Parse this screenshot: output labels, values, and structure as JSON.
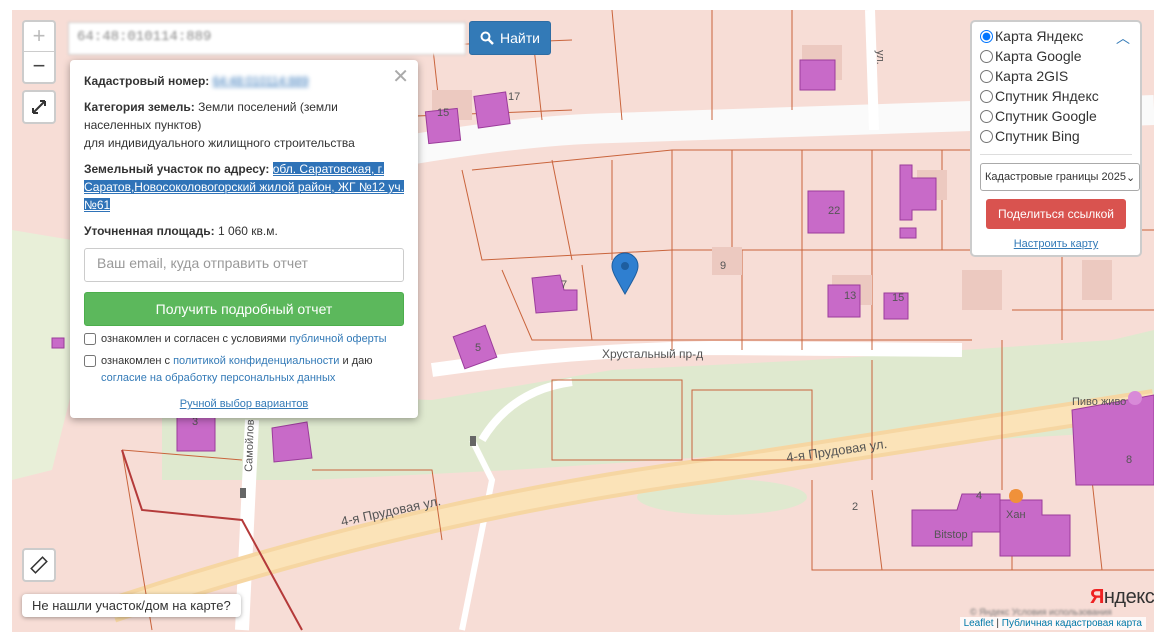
{
  "search": {
    "value": "64:48:010114:889",
    "button_label": "Найти"
  },
  "zoom": {
    "in_label": "+",
    "out_label": "−"
  },
  "popup": {
    "cadastral_label": "Кадастровый номер:",
    "cadastral_value": "64:48:010114:889",
    "category_label": "Категория земель:",
    "category_value_1": "Земли поселений (земли населенных пунктов)",
    "category_value_2": "для индивидуального жилищного строительства",
    "address_label": "Земельный участок по адресу:",
    "address_value": "обл. Саратовская, г. Саратов,Новосоколовогорский жилой район, ЖГ №12 уч. №61",
    "area_label": "Уточненная площадь:",
    "area_value": "1 060 кв.м.",
    "email_placeholder": "Ваш email, куда отправить отчет",
    "report_button": "Получить подробный отчет",
    "consent1_text": "ознакомлен и согласен с условиями",
    "consent1_link": "публичной оферты",
    "consent2_text": "ознакомлен с",
    "consent2_link1": "политикой конфиденциальности",
    "consent2_mid": "и даю",
    "consent2_link2": "согласие на обработку персональных данных",
    "manual_link": "Ручной выбор вариантов"
  },
  "layers": {
    "options": [
      "Карта Яндекс",
      "Карта Google",
      "Карта 2GIS",
      "Спутник Яндекс",
      "Спутник Google",
      "Спутник Bing"
    ],
    "selected": "Карта Яндекс",
    "select_value": "Кадастровые границы 2025",
    "share_button": "Поделиться ссылкой",
    "setup_link": "Настроить карту"
  },
  "map_labels": {
    "street_prudovaya_1": "4-я Прудовая ул.",
    "street_prudovaya_2": "4-я Прудовая ул.",
    "street_khrustalny": "Хрустальный пр-д",
    "street_samoylov": "Самойлов",
    "street_top": "ул.",
    "poi_pivo": "Пиво живо",
    "poi_khan": "Хан",
    "poi_bitstop": "Bitstop",
    "house_numbers": [
      "15",
      "17",
      "22",
      "9",
      "7",
      "13",
      "15",
      "5",
      "3",
      "8",
      "2",
      "4"
    ]
  },
  "not_found": "Не нашли участок/дом на карте?",
  "yandex": {
    "logo_ya": "Я",
    "logo_rest": "ндекс",
    "terms": "© Яндекс Условия использования"
  },
  "attribution": {
    "leaflet": "Leaflet",
    "sep": "|",
    "source": "Публичная кадастровая карта"
  },
  "colors": {
    "accent": "#337ab7",
    "success": "#5cb85c",
    "danger": "#d9534f",
    "parcel_border": "#c9643c",
    "building": "#c86ac8",
    "marker": "#2f7fd0"
  }
}
